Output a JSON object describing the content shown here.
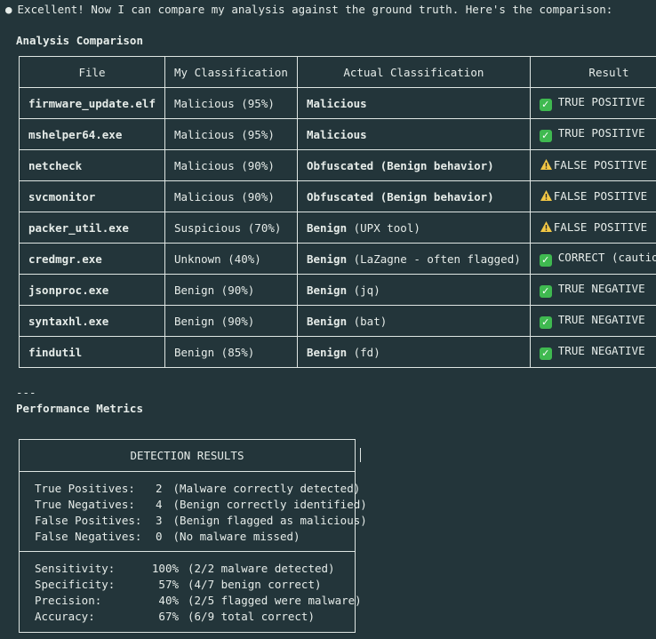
{
  "intro": {
    "bullet": "●",
    "text": "Excellent! Now I can compare my analysis against the ground truth. Here's the comparison:"
  },
  "comparison": {
    "title": "Analysis Comparison",
    "headers": [
      "File",
      "My Classification",
      "Actual Classification",
      "Result"
    ],
    "rows": [
      {
        "file": "firmware_update.elf",
        "mine": "Malicious (95%)",
        "actual_bold": "Malicious",
        "actual_rest": "",
        "icon": "check-icon",
        "result": "TRUE POSITIVE"
      },
      {
        "file": "mshelper64.exe",
        "mine": "Malicious (95%)",
        "actual_bold": "Malicious",
        "actual_rest": "",
        "icon": "check-icon",
        "result": "TRUE POSITIVE"
      },
      {
        "file": "netcheck",
        "mine": "Malicious (90%)",
        "actual_bold": "Obfuscated (Benign behavior)",
        "actual_rest": "",
        "icon": "warning-icon",
        "result": "FALSE POSITIVE"
      },
      {
        "file": "svcmonitor",
        "mine": "Malicious (90%)",
        "actual_bold": "Obfuscated (Benign behavior)",
        "actual_rest": "",
        "icon": "warning-icon",
        "result": "FALSE POSITIVE"
      },
      {
        "file": "packer_util.exe",
        "mine": "Suspicious (70%)",
        "actual_bold": "Benign",
        "actual_rest": " (UPX tool)",
        "icon": "warning-icon",
        "result": "FALSE POSITIVE"
      },
      {
        "file": "credmgr.exe",
        "mine": "Unknown (40%)",
        "actual_bold": "Benign",
        "actual_rest": " (LaZagne - often flagged)",
        "icon": "check-icon",
        "result": "CORRECT (cautious)"
      },
      {
        "file": "jsonproc.exe",
        "mine": "Benign (90%)",
        "actual_bold": "Benign",
        "actual_rest": " (jq)",
        "icon": "check-icon",
        "result": "TRUE NEGATIVE"
      },
      {
        "file": "syntaxhl.exe",
        "mine": "Benign (90%)",
        "actual_bold": "Benign",
        "actual_rest": " (bat)",
        "icon": "check-icon",
        "result": "TRUE NEGATIVE"
      },
      {
        "file": "findutil",
        "mine": "Benign (85%)",
        "actual_bold": "Benign",
        "actual_rest": " (fd)",
        "icon": "check-icon",
        "result": "TRUE NEGATIVE"
      }
    ]
  },
  "separator": "---",
  "metrics": {
    "title": "Performance Metrics",
    "box_header": "DETECTION RESULTS",
    "counts": [
      {
        "label": "True Positives:",
        "value": "2",
        "note": "(Malware correctly detected)"
      },
      {
        "label": "True Negatives:",
        "value": "4",
        "note": "(Benign correctly identified)"
      },
      {
        "label": "False Positives:",
        "value": "3",
        "note": "(Benign flagged as malicious)"
      },
      {
        "label": "False Negatives:",
        "value": "0",
        "note": "(No malware missed)"
      }
    ],
    "rates": [
      {
        "label": "Sensitivity:",
        "value": "100%",
        "note": "(2/2 malware detected)"
      },
      {
        "label": "Specificity:",
        "value": "57%",
        "note": "(4/7 benign correct)"
      },
      {
        "label": "Precision:",
        "value": "40%",
        "note": "(2/5 flagged were malware)"
      },
      {
        "label": "Accuracy:",
        "value": "67%",
        "note": "(6/9 total correct)"
      }
    ]
  },
  "colors": {
    "background": "#23353a",
    "text": "#e6ece9",
    "check": "#3fb950",
    "warning": "#f2c744"
  }
}
